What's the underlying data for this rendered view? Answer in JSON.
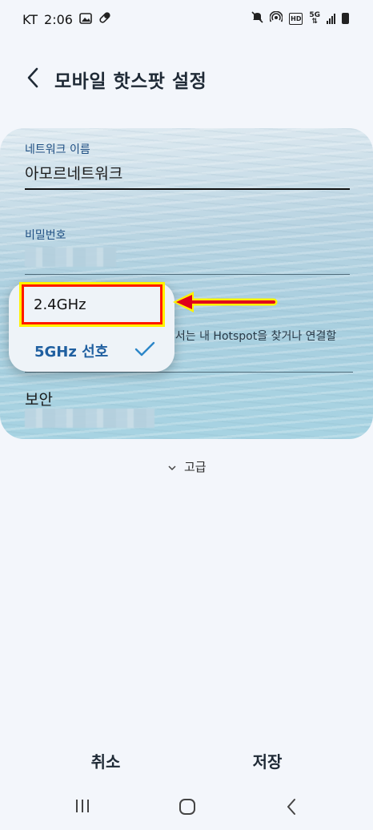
{
  "status_bar": {
    "carrier": "KT",
    "time": "2:06",
    "network_badge_top": "5G",
    "hd_badge": "HD"
  },
  "header": {
    "title": "모바일 핫스팟 설정"
  },
  "form": {
    "network_name": {
      "label": "네트워크 이름",
      "value": "아모르네트워크"
    },
    "password": {
      "label": "비밀번호"
    },
    "band_description_partial": "기서는 내 Hotspot을 찾거나 연결할",
    "security": {
      "label": "보안"
    }
  },
  "band_dropdown": {
    "options": [
      "2.4GHz",
      "5GHz 선호"
    ],
    "selected": "5GHz 선호"
  },
  "advanced": {
    "label": "고급"
  },
  "buttons": {
    "cancel": "취소",
    "save": "저장"
  },
  "colors": {
    "accent": "#1f5fa0",
    "highlight_border": "#ff1a00",
    "highlight_glow": "#fff200",
    "arrow": "#e0001b"
  }
}
